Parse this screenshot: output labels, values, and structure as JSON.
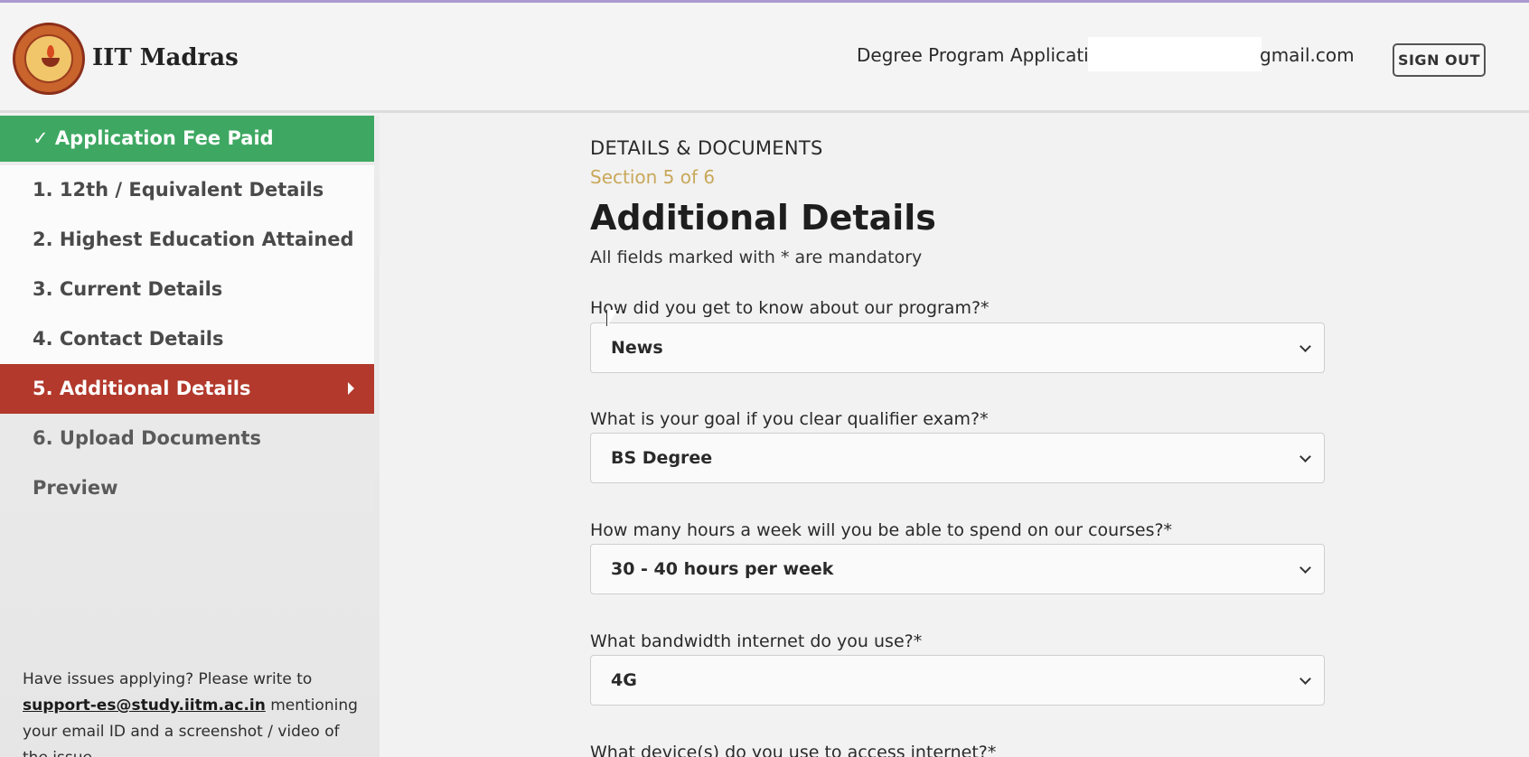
{
  "header": {
    "brand": "IIT Madras",
    "program_label": "Degree Program Application",
    "email_suffix": "gmail.com",
    "signout_label": "SIGN OUT"
  },
  "sidebar": {
    "items": [
      {
        "label": "✓ Application Fee Paid",
        "state": "paid"
      },
      {
        "label": "1. 12th / Equivalent Details",
        "state": "normal"
      },
      {
        "label": "2. Highest Education Attained",
        "state": "normal"
      },
      {
        "label": "3. Current Details",
        "state": "normal"
      },
      {
        "label": "4. Contact Details",
        "state": "normal"
      },
      {
        "label": "5. Additional Details",
        "state": "active"
      },
      {
        "label": "6. Upload Documents",
        "state": "dim"
      },
      {
        "label": "Preview",
        "state": "dim"
      }
    ],
    "help": {
      "prefix": "Have issues applying? Please write to",
      "link": "support-es@study.iitm.ac.in",
      "suffix": "mentioning your email ID and a screenshot / video of the issue."
    }
  },
  "main": {
    "section_title": "DETAILS & DOCUMENTS",
    "section_num": "Section 5 of 6",
    "page_title": "Additional Details",
    "mandatory_note": "All fields marked with * are mandatory",
    "questions": [
      {
        "label": "How did you get to know about our program?*",
        "value": "News"
      },
      {
        "label": "What is your goal if you clear qualifier exam?*",
        "value": "BS Degree"
      },
      {
        "label": "How many hours a week will you be able to spend on our courses?*",
        "value": "30 - 40 hours per week"
      },
      {
        "label": "What bandwidth internet do you use?*",
        "value": "4G"
      },
      {
        "label": "What device(s) do you use to access internet?*",
        "value": ""
      }
    ]
  },
  "colors": {
    "paid": "#3ea862",
    "active": "#b2392c",
    "section_num": "#c9a85a"
  }
}
